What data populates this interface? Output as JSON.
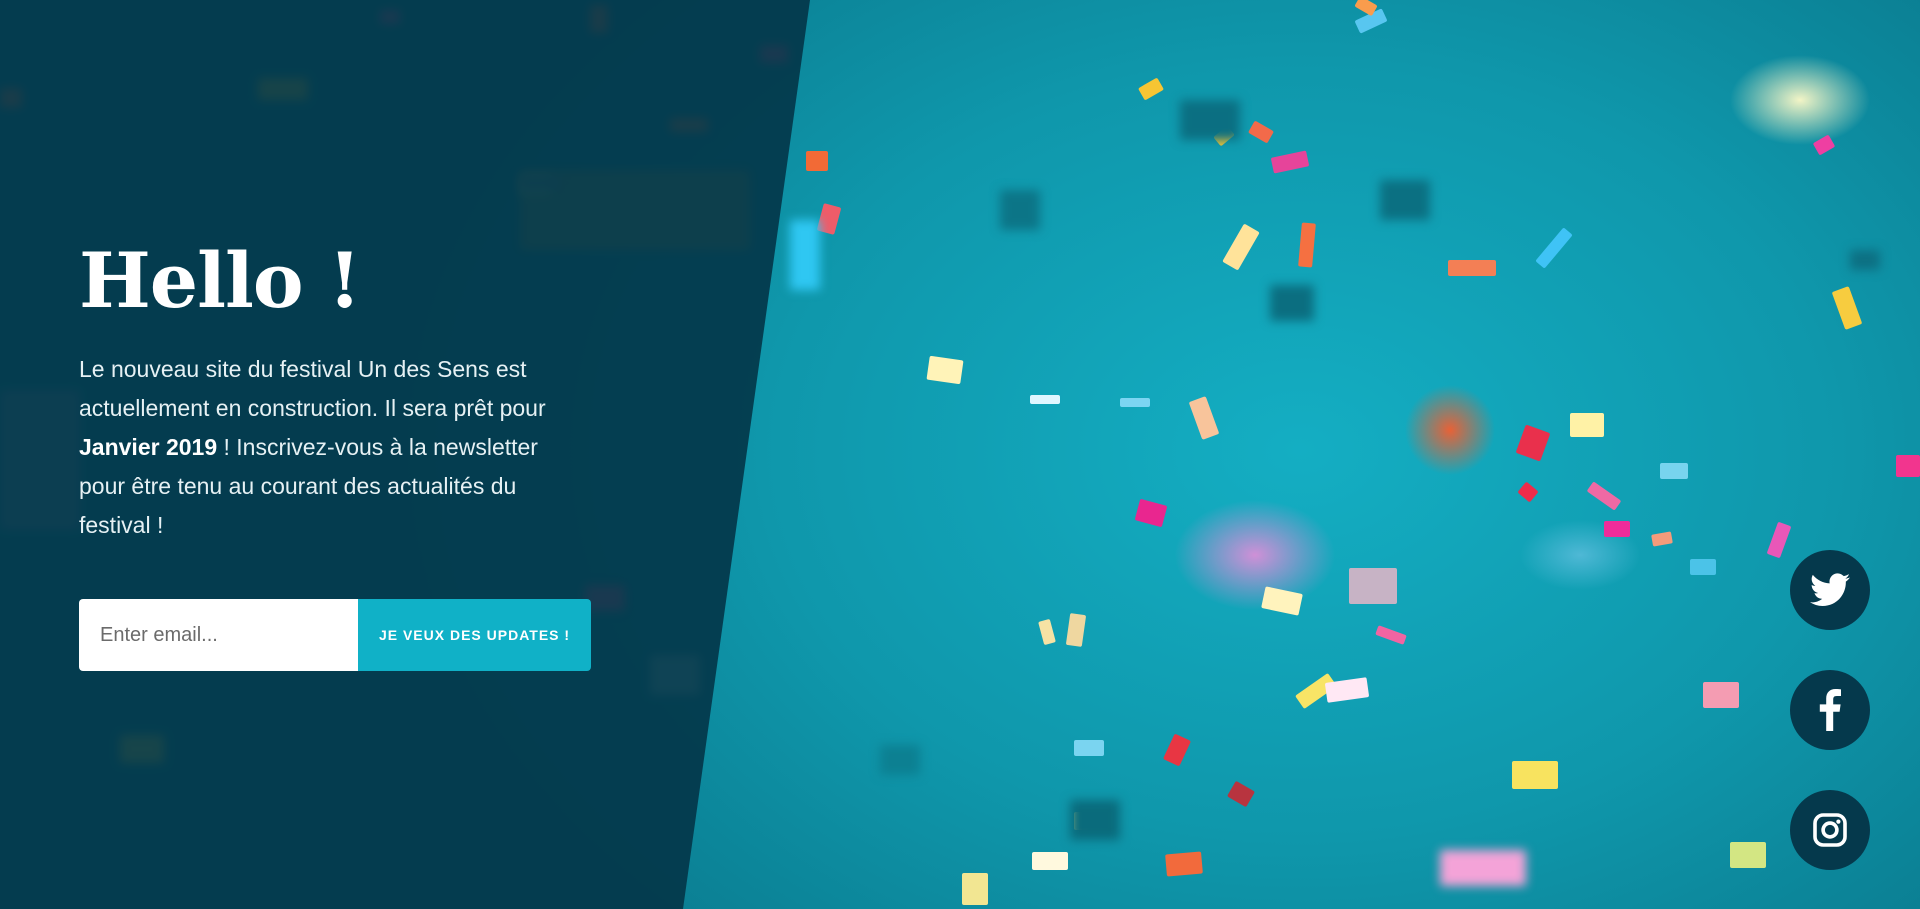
{
  "hero": {
    "title": "Hello !",
    "description_before": "Le nouveau site du festival Un des Sens est actuellement en construction. Il sera prêt pour ",
    "description_highlight": "Janvier 2019",
    "description_after": " ! Inscrivez-vous à la newsletter pour être tenu au courant des actualités du festival !"
  },
  "newsletter": {
    "email_placeholder": "Enter email...",
    "email_value": "",
    "submit_label": "JE VEUX DES UPDATES !"
  },
  "social": [
    {
      "name": "twitter",
      "icon": "twitter-icon"
    },
    {
      "name": "facebook",
      "icon": "facebook-icon"
    },
    {
      "name": "instagram",
      "icon": "instagram-icon"
    }
  ],
  "colors": {
    "panel": "#033648",
    "accent": "#10b1c7",
    "social_bg": "#05394c",
    "background": "#11aabc"
  }
}
